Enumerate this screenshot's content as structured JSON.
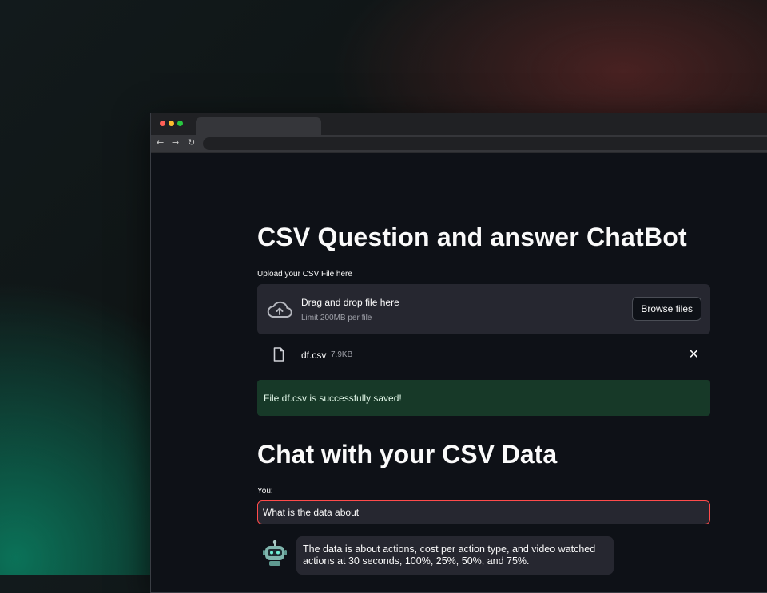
{
  "page": {
    "title": "CSV Question and answer ChatBot",
    "subtitle": "Chat with your CSV Data"
  },
  "uploader": {
    "label": "Upload your CSV File here",
    "drop_title": "Drag and drop file here",
    "drop_limit": "Limit 200MB per file",
    "browse_label": "Browse files",
    "icon": "cloud-upload-icon"
  },
  "uploaded_file": {
    "name": "df.csv",
    "size": "7.9KB",
    "icon": "file-icon",
    "remove_glyph": "✕"
  },
  "alert": {
    "message": "File df.csv is successfully saved!",
    "color": "#173928"
  },
  "chat": {
    "input_label": "You:",
    "input_value": "What is the data about",
    "response": "The data is about actions, cost per action type, and video watched actions at 30 seconds, 100%, 25%, 50%, and 75%."
  },
  "colors": {
    "background": "#0e1117",
    "surface": "#262730",
    "accent_border": "#ff4b4b",
    "text": "#fafafa"
  }
}
